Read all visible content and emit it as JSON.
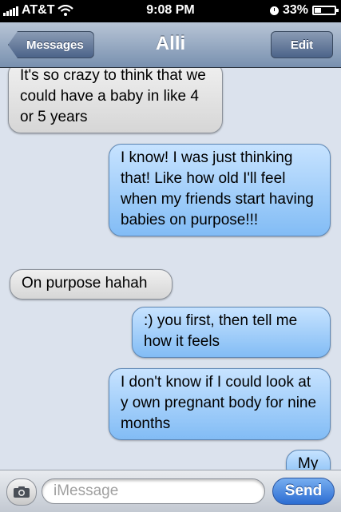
{
  "status_bar": {
    "carrier": "AT&T",
    "time": "9:08 PM",
    "battery": "33%",
    "battery_level": 0.33
  },
  "nav": {
    "back_label": "Messages",
    "title": "Alli",
    "edit_label": "Edit"
  },
  "messages": [
    {
      "from": "them",
      "text": "It's so crazy to think that we could have a baby in like 4 or 5 years"
    },
    {
      "from": "me",
      "text": "I know! I was just thinking that! Like how old I'll feel when my friends start having babies on purpose!!!"
    },
    {
      "from": "them",
      "text": "On purpose hahah"
    },
    {
      "from": "me",
      "text": ":) you first, then tell me how it feels"
    },
    {
      "from": "me",
      "text": "I don't know if I could look at y own pregnant body for nine months"
    },
    {
      "from": "me",
      "text": "My"
    }
  ],
  "input": {
    "placeholder": "iMessage",
    "value": "",
    "send_label": "Send"
  },
  "icons": {
    "camera": "camera-icon",
    "wifi": "wifi-icon",
    "signal": "signal-icon",
    "alarm": "alarm-icon",
    "battery": "battery-icon"
  },
  "colors": {
    "sent_bubble": "#82bcf5",
    "received_bubble": "#e2e2e2",
    "background": "#dbe2ed",
    "send_button": "#2c6dd2"
  }
}
